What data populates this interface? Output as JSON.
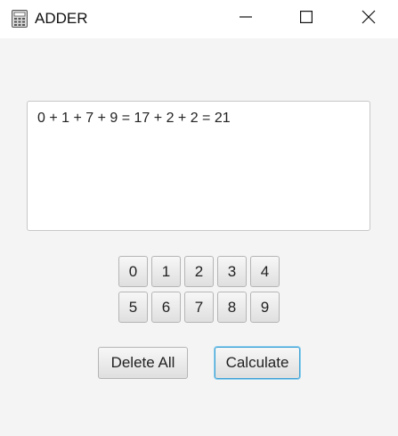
{
  "window": {
    "title": "ADDER",
    "icon": "calculator-icon",
    "controls": [
      "minimize-icon",
      "maximize-icon",
      "close-icon"
    ]
  },
  "display": {
    "text": "0 + 1 + 7 + 9 = 17 + 2 + 2 = 21"
  },
  "keypad": {
    "digits": [
      "0",
      "1",
      "2",
      "3",
      "4",
      "5",
      "6",
      "7",
      "8",
      "9"
    ]
  },
  "actions": {
    "delete_all_label": "Delete All",
    "calculate_label": "Calculate"
  },
  "colors": {
    "background": "#f4f4f4",
    "focus_border": "#3fa2d6"
  }
}
